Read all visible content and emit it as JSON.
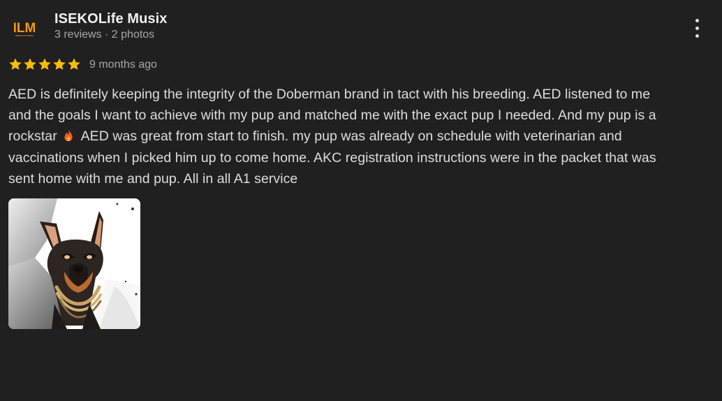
{
  "reviewer": {
    "name": "ISEKOLife Musix",
    "meta": "3 reviews · 2 photos",
    "avatar_text": "ILM",
    "avatar_subtext": "ISEKOLIFE MUSIX",
    "avatar_color": "#f29a12"
  },
  "review": {
    "rating": 5,
    "max_rating": 5,
    "age": "9 months ago",
    "text_lines": [
      "AED is definitely keeping the integrity of the Doberman brand in tact with his breeding. AED listened to me",
      "and the goals I want to achieve with my pup and matched me with the exact pup I needed. And my pup is a",
      "rockstar",
      "AED was great from start to finish. my pup was already on schedule with veterinarian and",
      "vaccinations when I picked him up to come home. AKC registration instructions were in the packet that was",
      "sent home with me and pup. All in all A1 service"
    ],
    "emoji": "fire-icon"
  },
  "menu": {
    "icon": "more-vert-icon"
  },
  "photo": {
    "subject": "doberman-photo"
  },
  "colors": {
    "background": "#202020",
    "primary_text": "#dedede",
    "secondary_text": "#a8a8a8",
    "star": "#fbbc04"
  }
}
